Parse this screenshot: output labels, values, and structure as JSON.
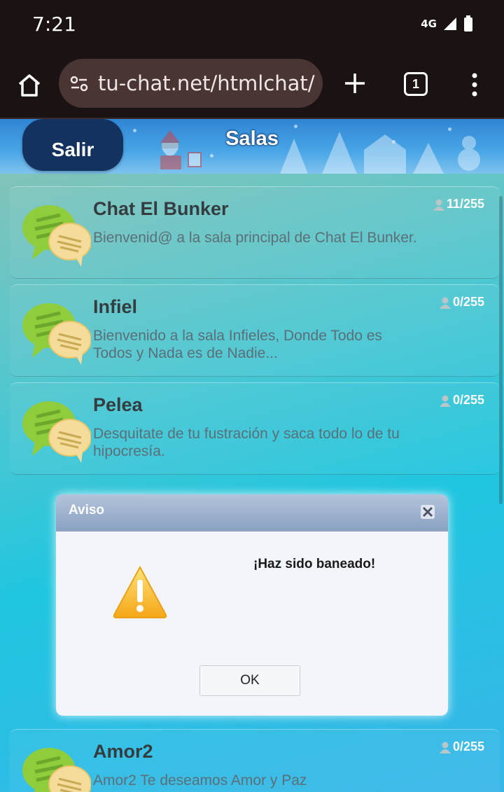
{
  "status_bar": {
    "time": "7:21",
    "network": "4G"
  },
  "browser": {
    "url": "tu-chat.net/htmlchat/",
    "tab_count": "1"
  },
  "header": {
    "exit_label": "Salir",
    "title": "Salas"
  },
  "rooms": [
    {
      "name": "Chat El Bunker",
      "description": "Bienvenid@ a la sala principal de Chat El Bunker.",
      "count": "11/255"
    },
    {
      "name": "Infiel",
      "description": "Bienvenido a la sala Infieles, Donde Todo es Todos y Nada es de Nadie...",
      "count": "0/255"
    },
    {
      "name": "Pelea",
      "description": "Desquitate de tu fustración y saca todo lo de tu hipocresía.",
      "count": "0/255"
    },
    {
      "name": "Amor2",
      "description": "Amor2 Te deseamos Amor y Paz",
      "count": "0/255"
    }
  ],
  "dialog": {
    "title": "Aviso",
    "message": "¡Haz sido baneado!",
    "ok_label": "OK"
  },
  "colors": {
    "header_blue": "#2f86d4",
    "exit_button": "#14325f",
    "dialog_titlebar": "#8aa1c2",
    "warning": "#f5b323"
  },
  "icons": [
    "home-icon",
    "site-settings-icon",
    "plus-icon",
    "tabs-icon",
    "more-vert-icon",
    "chat-bubbles-icon",
    "user-icon",
    "close-icon",
    "warning-icon"
  ]
}
